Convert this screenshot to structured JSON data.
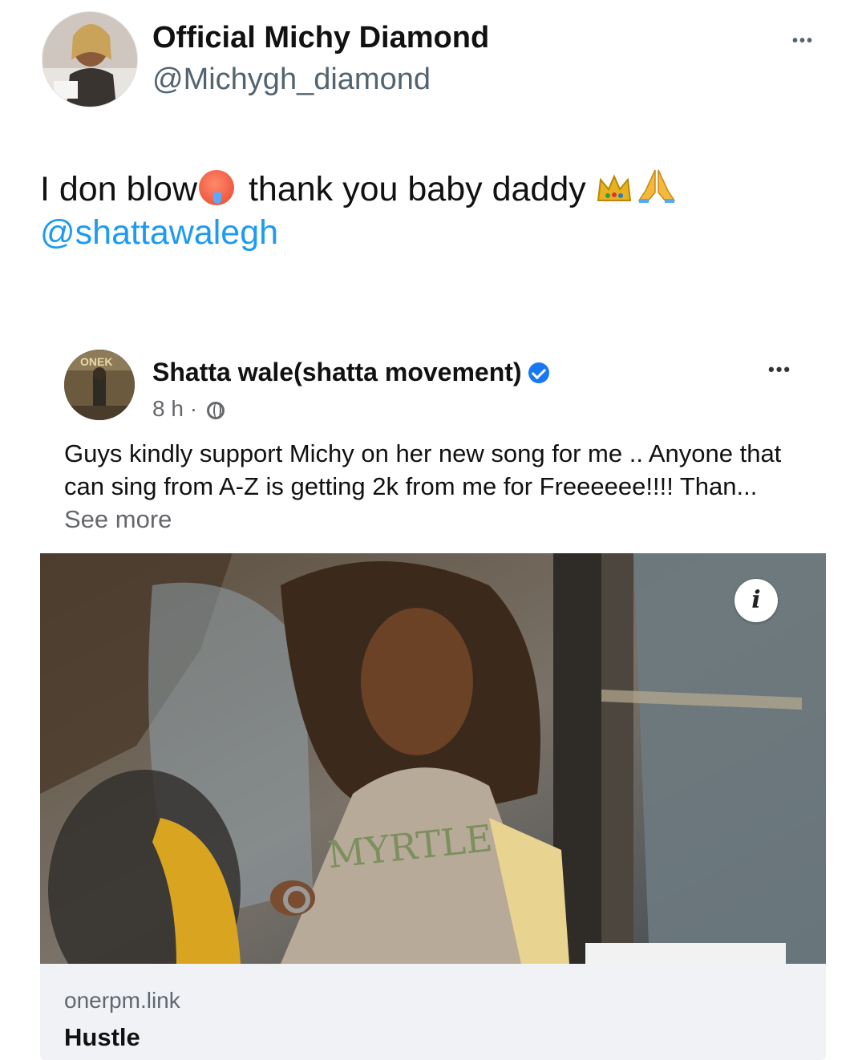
{
  "tweet": {
    "author_name": "Official Michy Diamond",
    "author_handle": "@Michygh_diamond",
    "text_part1": "I don blow",
    "text_part2": "thank you baby daddy",
    "mention": "@shattawalegh",
    "more_label": "•••"
  },
  "fb_post": {
    "author_name": "Shatta wale(shatta movement)",
    "time": "8 h ·",
    "text": "Guys kindly support Michy on her new song  for me .. Anyone that can sing from A-Z is getting 2k from me for Freeeeee!!!! Than...",
    "see_more": "See more",
    "more_label": "•••",
    "avatar_banner_text": "ONEK"
  },
  "link_preview": {
    "info_label": "i",
    "domain": "onerpm.link",
    "title": "Hustle",
    "shirt_text": "MYRTLE"
  },
  "icons": {
    "tweet_emojis": [
      "hot-face-emoji",
      "crown-emoji",
      "pray-emoji"
    ],
    "verified": "verified-badge-icon",
    "audience": "globe-icon"
  },
  "colors": {
    "mention": "#1d9bf0",
    "verified": "#1877f2",
    "muted": "#65676b"
  }
}
